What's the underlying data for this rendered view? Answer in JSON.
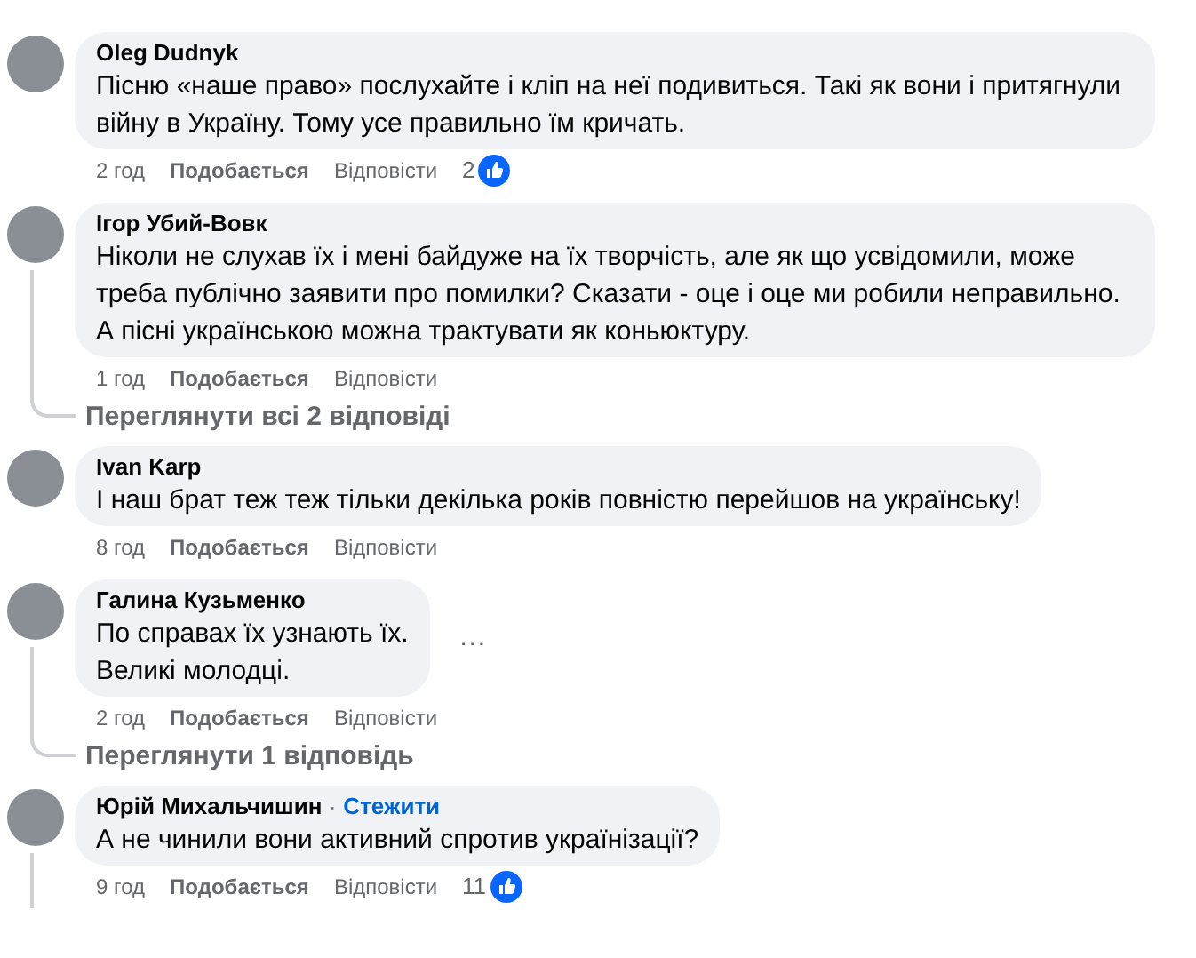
{
  "comments": [
    {
      "author": "Oleg Dudnyk",
      "text": "Пісню «наше право» послухайте і кліп на неї подивиться. Такі як вони і притягнули війну в Україну. Тому усе правильно їм кричать.",
      "time": "2 год",
      "like": "Подобається",
      "reply": "Відповісти",
      "likes": "2",
      "thread": false
    },
    {
      "author": "Ігор Убий-Вовк",
      "text": "Ніколи не слухав їх і мені байдуже на їх творчість, але як що усвідомили, може треба публічно заявити про помилки? Сказати - оце і оце ми робили неправильно. А пісні українською можна трактувати як коньюктуру.",
      "time": "1 год",
      "like": "Подобається",
      "reply": "Відповісти",
      "thread": true,
      "replies_link": "Переглянути всі 2 відповіді"
    },
    {
      "author": "Ivan Karp",
      "text": "І наш брат теж теж тільки декілька років повністю перейшов на українську!",
      "time": "8 год",
      "like": "Подобається",
      "reply": "Відповісти",
      "thread": false
    },
    {
      "author": "Галина Кузьменко",
      "text": "По справах їх узнають їх.\nВеликі молодці.",
      "time": "2 год",
      "like": "Подобається",
      "reply": "Відповісти",
      "more": "…",
      "thread": true,
      "replies_link": "Переглянути 1 відповідь"
    },
    {
      "author": "Юрій Михальчишин",
      "follow_separator": "·",
      "follow": "Стежити",
      "text": "А не чинили вони активний спротив українізації?",
      "time": "9 год",
      "like": "Подобається",
      "reply": "Відповісти",
      "likes": "11",
      "thread": true
    }
  ]
}
